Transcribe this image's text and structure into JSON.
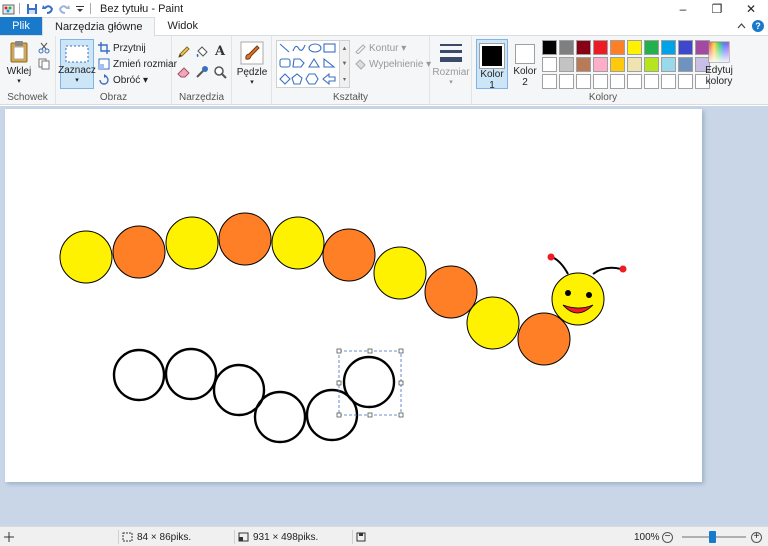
{
  "titlebar": {
    "title": "Bez tytułu - Paint",
    "buttons": {
      "minimize": "–",
      "maximize": "❐",
      "close": "✕"
    }
  },
  "tabs": {
    "file": "Plik",
    "home": "Narzędzia główne",
    "view": "Widok"
  },
  "ribbon": {
    "clipboard": {
      "group_label": "Schowek",
      "paste": "Wklej"
    },
    "image": {
      "group_label": "Obraz",
      "select": "Zaznacz",
      "crop": "Przytnij",
      "resize": "Zmień rozmiar",
      "rotate": "Obróć ▾"
    },
    "tools": {
      "group_label": "Narzędzia"
    },
    "brushes": {
      "label": "Pędzle"
    },
    "shapes": {
      "group_label": "Kształty",
      "outline": "Kontur ▾",
      "fill": "Wypełnienie ▾"
    },
    "size": {
      "label": "Rozmiar"
    },
    "colors": {
      "group_label": "Kolory",
      "color1": "Kolor 1",
      "color2": "Kolor 2",
      "edit": "Edytuj kolory",
      "color1_value": "#000000",
      "color2_value": "#ffffff",
      "palette": [
        [
          "#000000",
          "#7f7f7f",
          "#880015",
          "#ed1c24",
          "#ff7f27",
          "#fff200",
          "#22b14c",
          "#00a2e8",
          "#3f48cc",
          "#a349a4"
        ],
        [
          "#ffffff",
          "#c3c3c3",
          "#b97a57",
          "#ffaec9",
          "#ffc90e",
          "#efe4b0",
          "#b5e61d",
          "#99d9ea",
          "#7092be",
          "#c8bfe7"
        ],
        [
          "#ffffff",
          "#ffffff",
          "#ffffff",
          "#ffffff",
          "#ffffff",
          "#ffffff",
          "#ffffff",
          "#ffffff",
          "#ffffff",
          "#ffffff"
        ]
      ]
    }
  },
  "canvas": {
    "colors": {
      "yellow": "#fff200",
      "orange": "#ff7f27",
      "outline": "#000000",
      "mouth": "#ed1c24",
      "antenna_tip": "#ed1c24"
    }
  },
  "statusbar": {
    "selection_size": "84 × 86piks.",
    "image_size": "931 × 498piks.",
    "zoom": "100%",
    "zoom_minus": "−",
    "zoom_plus": "+"
  }
}
